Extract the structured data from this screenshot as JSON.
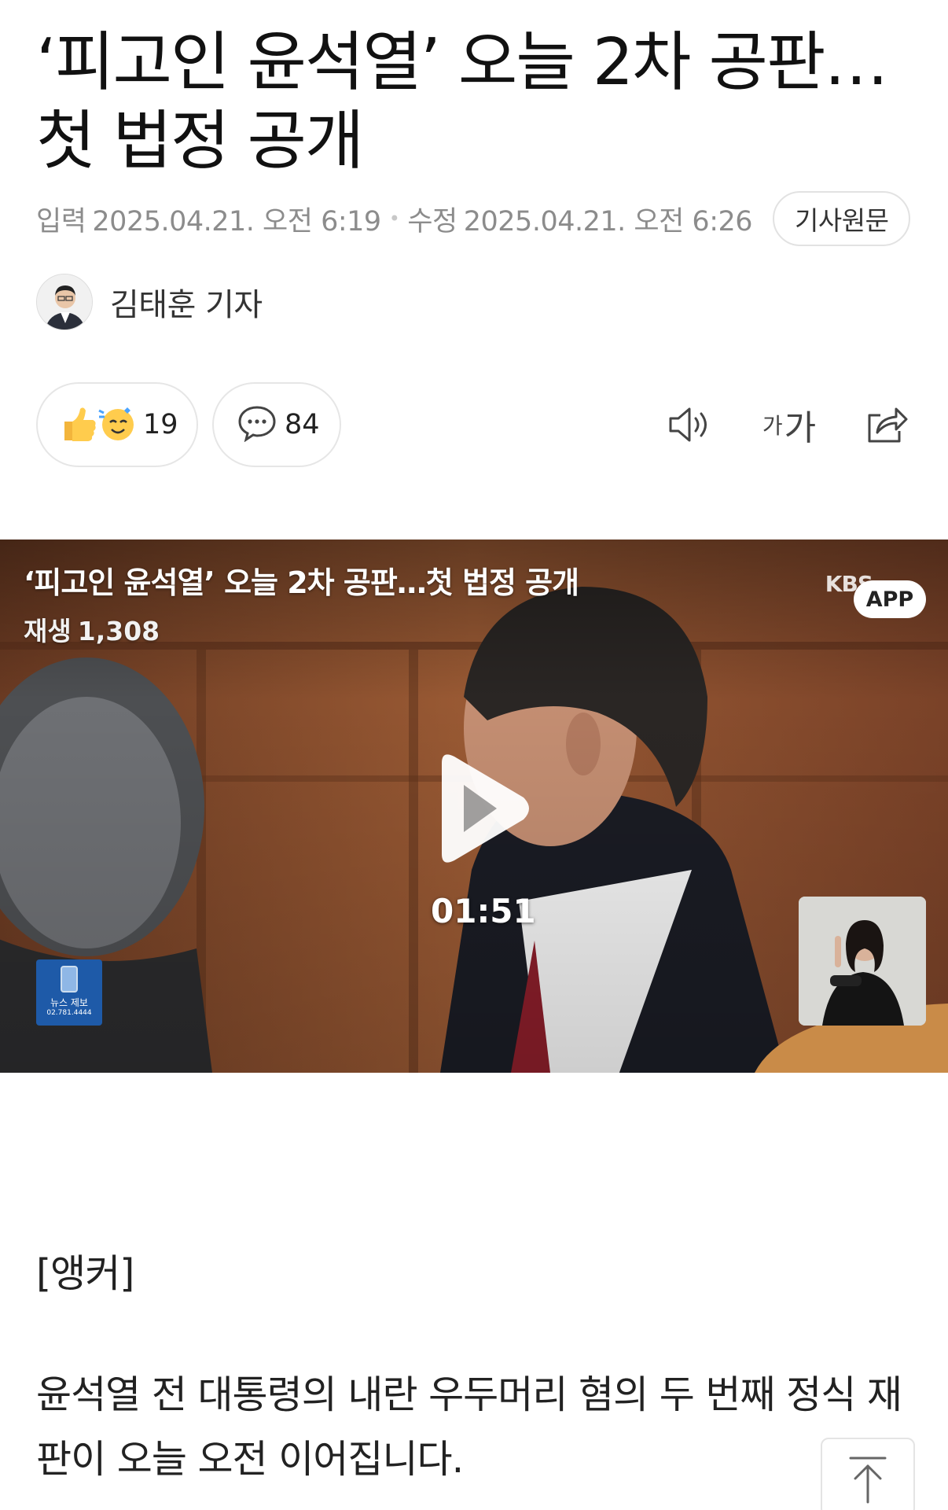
{
  "article": {
    "title": "‘피고인 윤석열’ 오늘 2차 공판…첫 법정 공개",
    "meta": {
      "input_label": "입력",
      "input_date": "2025.04.21. 오전 6:19",
      "modified_label": "수정",
      "modified_date": "2025.04.21. 오전 6:26",
      "original_button": "기사원문"
    },
    "author": {
      "name": "김태훈 기자"
    }
  },
  "actions": {
    "reactions_count": "19",
    "comments_count": "84",
    "font_small": "가",
    "font_large": "가"
  },
  "video": {
    "title": "‘피고인 윤석열’ 오늘 2차 공판…첫 법정 공개",
    "views_label": "재생",
    "views_count": "1,308",
    "duration": "01:51",
    "channel": "KBS",
    "app_badge": "APP",
    "tip_text": "뉴스 제보",
    "tip_phone": "02.781.4444"
  },
  "body": {
    "anchor": "[앵커]",
    "paragraph": "윤석열 전 대통령의 내란 우두머리 혐의 두 번째 정식 재판이 오늘 오전 이어집니다."
  },
  "colors": {
    "meta_text": "#8c8c8c",
    "border": "#e6e6e6",
    "video_bg": "#5a3320"
  },
  "icons": {
    "reaction": "thumbs-up-smile-icon",
    "comment": "speech-bubble-icon",
    "tts": "speaker-icon",
    "share": "share-icon",
    "play": "play-icon",
    "top": "arrow-up-icon"
  }
}
